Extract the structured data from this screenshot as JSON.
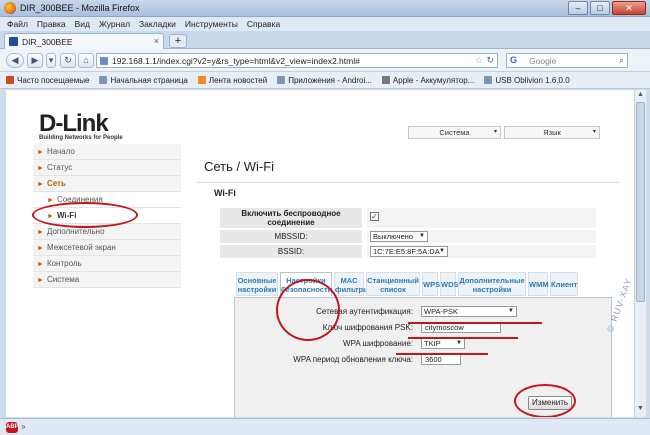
{
  "window": {
    "title": "DIR_300BEE - Mozilla Firefox",
    "min": "–",
    "max": "□",
    "close": "✕"
  },
  "menu": [
    "Файл",
    "Правка",
    "Вид",
    "Журнал",
    "Закладки",
    "Инструменты",
    "Справка"
  ],
  "tab": {
    "title": "DIR_300BEE",
    "close": "×",
    "new_tab": "+"
  },
  "nav": {
    "back": "◀",
    "forward": "▶",
    "history": "▾",
    "url": "192.168.1.1/index.cgi?v2=y&rs_type=html&v2_view=index2.html#",
    "search_placeholder": "Google",
    "search_engine_icon": "G",
    "search_icon": "⌕",
    "star": "☆",
    "reload": "↻",
    "home": "⌂"
  },
  "bookmarks": [
    {
      "label": "Часто посещаемые",
      "icon": "bookmark-icon",
      "color": "#d04a1e"
    },
    {
      "label": "Начальная страница",
      "icon": "page-icon",
      "color": "#7d96b8"
    },
    {
      "label": "Лента новостей",
      "icon": "rss-icon",
      "color": "#f08a1e"
    },
    {
      "label": "Приложения - Androi...",
      "icon": "page-icon",
      "color": "#7d96b8"
    },
    {
      "label": "Apple - Аккумулятор...",
      "icon": "apple-icon",
      "color": "#777777"
    },
    {
      "label": "USB Oblivion 1.6.0.0",
      "icon": "page-icon",
      "color": "#7d96b8"
    }
  ],
  "brand": {
    "logo": "D-Link",
    "tagline": "Building Networks for People"
  },
  "top_selects": {
    "system": "Система",
    "language": "Язык"
  },
  "sidebar": [
    {
      "label": "Начало",
      "state": "normal"
    },
    {
      "label": "Статус",
      "state": "normal"
    },
    {
      "label": "Сеть",
      "state": "active"
    },
    {
      "label": "Соединения",
      "state": "sub"
    },
    {
      "label": "Wi-Fi",
      "state": "sub-current"
    },
    {
      "label": "Дополнительно",
      "state": "normal"
    },
    {
      "label": "Межсетевой экран",
      "state": "normal"
    },
    {
      "label": "Контроль",
      "state": "normal"
    },
    {
      "label": "Система",
      "state": "normal"
    }
  ],
  "page_title": "Сеть / Wi-Fi",
  "section_title": "Wi-Fi",
  "wifi_form": {
    "enable_label": "Включить беспроводное соединение",
    "enable_checked": "✓",
    "mbssid_label": "MBSSID:",
    "mbssid_value": "Выключено",
    "bssid_label": "BSSID:",
    "bssid_value": "1C:7E:E5:8F:5A:DA"
  },
  "tabs": [
    {
      "label": "Основные настройки"
    },
    {
      "label": "Настройки безопасности"
    },
    {
      "label": "MAC фильтры"
    },
    {
      "label": "Станционный список"
    },
    {
      "label": "WPS"
    },
    {
      "label": "WDS"
    },
    {
      "label": "Дополнительные настройки"
    },
    {
      "label": "WMM"
    },
    {
      "label": "Клиент"
    }
  ],
  "security": {
    "auth_label": "Сетевая аутентификация:",
    "auth_value": "WPA-PSK",
    "psk_label": "Ключ шифрования PSK:",
    "psk_value": "citymoscow",
    "enc_label": "WPA шифрование:",
    "enc_value": "TKIP",
    "period_label": "WPA период обновления ключа:",
    "period_value": "3600",
    "change_button": "Изменить"
  },
  "status": {
    "abp": "ABP",
    "chevron": "»"
  },
  "watermark": "© RUV-XAY",
  "colors": {
    "accent": "#c25b00",
    "annotation": "#c4161c",
    "tab_link": "#2d7bb3"
  }
}
